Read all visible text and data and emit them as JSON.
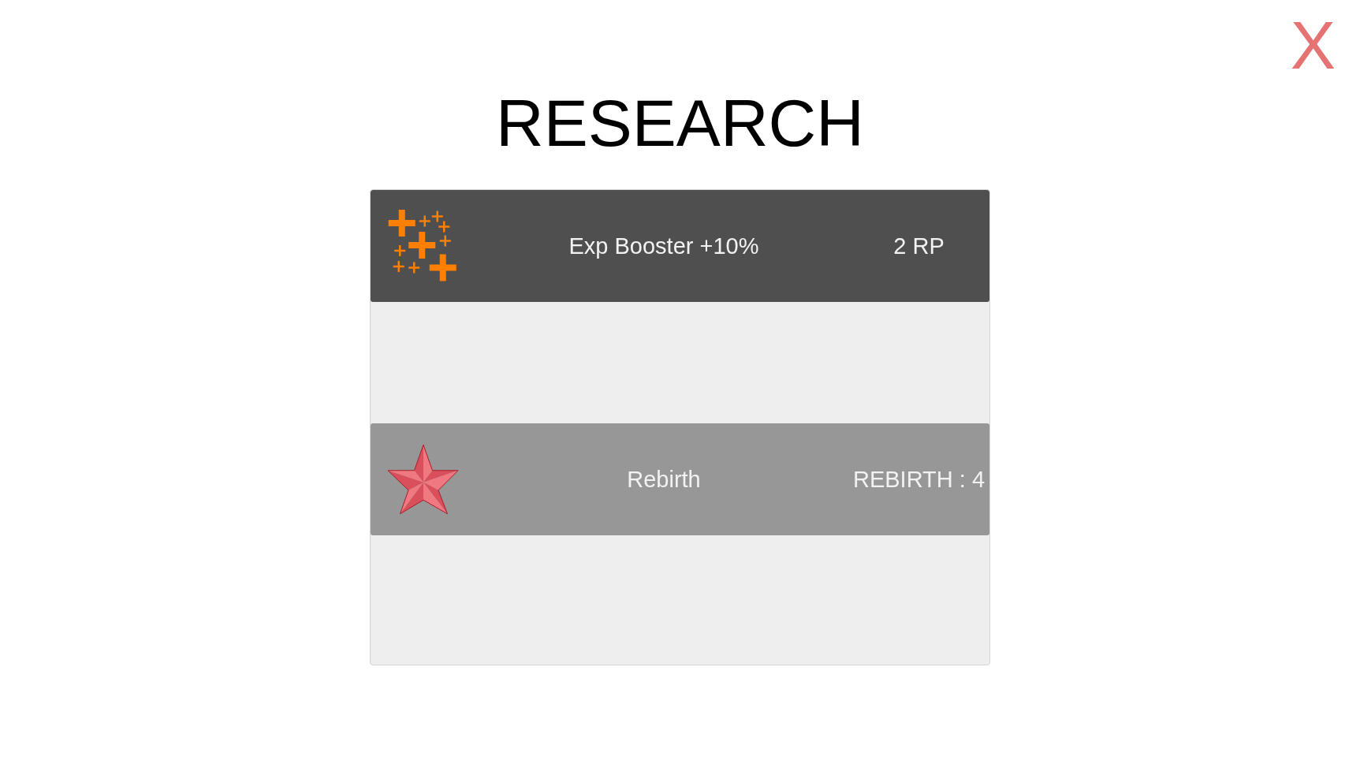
{
  "close_button": {
    "label": "X"
  },
  "title": "RESEARCH",
  "research_items": [
    {
      "kind": "booster",
      "name": "Exp Booster +10%",
      "cost": "2 RP",
      "disabled": false
    },
    {
      "kind": "rebirth",
      "name": "Rebirth",
      "cost": "REBIRTH : 4",
      "disabled": true
    }
  ]
}
